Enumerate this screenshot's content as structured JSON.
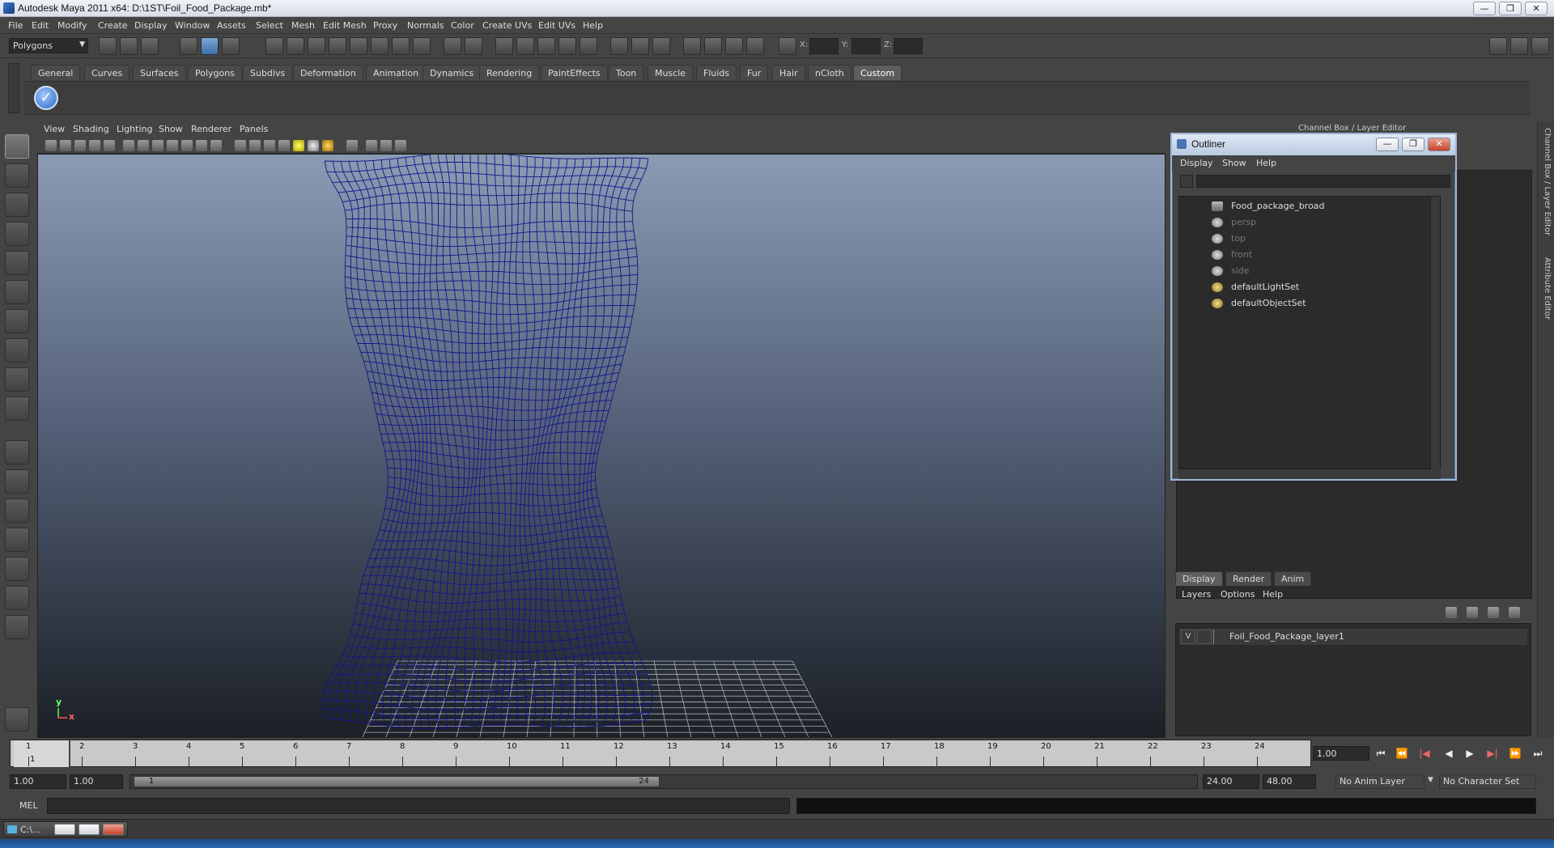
{
  "window": {
    "title": "Autodesk Maya 2011 x64: D:\\1ST\\Foil_Food_Package.mb*",
    "min": "—",
    "max": "❐",
    "close": "✕"
  },
  "menubar": [
    "File",
    "Edit",
    "Modify",
    "Create",
    "Display",
    "Window",
    "Assets",
    "Select",
    "Mesh",
    "Edit Mesh",
    "Proxy",
    "Normals",
    "Color",
    "Create UVs",
    "Edit UVs",
    "Help"
  ],
  "statusline": {
    "mode": "Polygons",
    "x_label": "X:",
    "y_label": "Y:",
    "z_label": "Z:"
  },
  "shelf_tabs": [
    "General",
    "Curves",
    "Surfaces",
    "Polygons",
    "Subdivs",
    "Deformation",
    "Animation",
    "Dynamics",
    "Rendering",
    "PaintEffects",
    "Toon",
    "Muscle",
    "Fluids",
    "Fur",
    "Hair",
    "nCloth",
    "Custom"
  ],
  "shelf_active": "Custom",
  "shelf_check_glyph": "✓",
  "viewport": {
    "menu": [
      "View",
      "Shading",
      "Lighting",
      "Show",
      "Renderer",
      "Panels"
    ],
    "axis_y": "y",
    "axis_x": "x",
    "mesh_color": "#14148c"
  },
  "channel_box_title": "Channel Box / Layer Editor",
  "right_dock_tabs": [
    "Channel Box / Layer Editor",
    "Attribute Editor"
  ],
  "outliner": {
    "title": "Outliner",
    "menu": [
      "Display",
      "Show",
      "Help"
    ],
    "items": [
      {
        "label": "Food_package_broad",
        "dim": false
      },
      {
        "label": "persp",
        "dim": true
      },
      {
        "label": "top",
        "dim": true
      },
      {
        "label": "front",
        "dim": true
      },
      {
        "label": "side",
        "dim": true
      },
      {
        "label": "defaultLightSet",
        "dim": false
      },
      {
        "label": "defaultObjectSet",
        "dim": false
      }
    ]
  },
  "layer_editor": {
    "tabs": [
      "Display",
      "Render",
      "Anim"
    ],
    "active_tab": "Display",
    "menu": [
      "Layers",
      "Options",
      "Help"
    ],
    "layer": {
      "visible": "V",
      "name": "Foil_Food_Package_layer1"
    }
  },
  "timeline": {
    "ticks": [
      1,
      2,
      3,
      4,
      5,
      6,
      7,
      8,
      9,
      10,
      11,
      12,
      13,
      14,
      15,
      16,
      17,
      18,
      19,
      20,
      21,
      22,
      23,
      24
    ],
    "current_label": "1",
    "current_frame": "1.00",
    "playback": [
      "⏮",
      "⏪",
      "|◀",
      "◀",
      "▶",
      "▶|",
      "⏩",
      "⏭"
    ]
  },
  "range": {
    "start_time": "1.00",
    "playback_start": "1.00",
    "range_start": "1",
    "range_end": "24",
    "playback_end": "24.00",
    "end_time": "48.00",
    "anim_layer": "No Anim Layer",
    "character_set": "No Character Set"
  },
  "command_line": {
    "label": "MEL"
  },
  "taskbar": {
    "item": "C:\\..."
  }
}
